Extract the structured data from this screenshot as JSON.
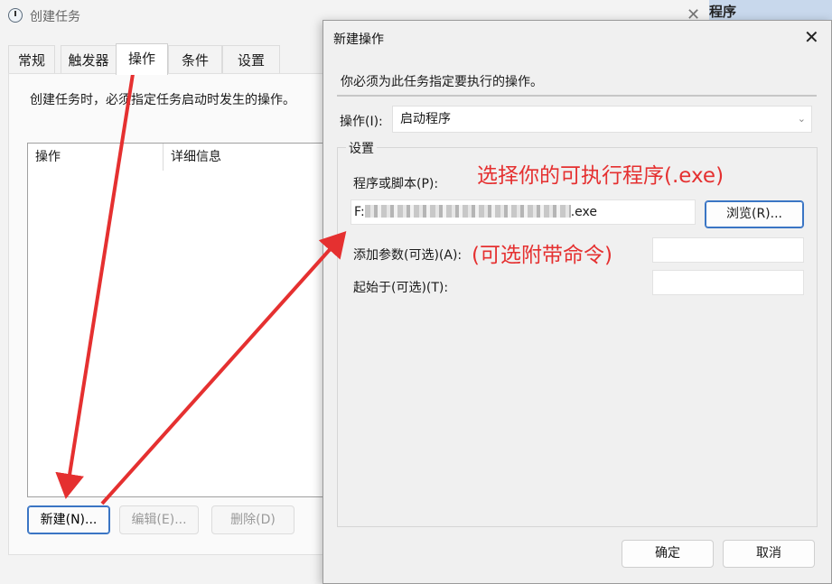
{
  "background_window": {
    "title": "创建任务",
    "tabs": [
      "常规",
      "触发器",
      "操作",
      "条件",
      "设置"
    ],
    "active_tab": "操作",
    "description": "创建任务时，必须指定任务启动时发生的操作。",
    "table_headers": [
      "操作",
      "详细信息"
    ],
    "buttons": {
      "new": "新建(N)...",
      "edit": "编辑(E)...",
      "delete": "删除(D)"
    },
    "right_window_fragment": "程序"
  },
  "dialog": {
    "title": "新建操作",
    "instruction": "你必须为此任务指定要执行的操作。",
    "action_label": "操作(I):",
    "action_value": "启动程序",
    "settings_legend": "设置",
    "program_label": "程序或脚本(P):",
    "program_value_prefix": "F:",
    "program_value_suffix": ".exe",
    "browse_button": "浏览(R)...",
    "args_label": "添加参数(可选)(A):",
    "start_in_label": "起始于(可选)(T):",
    "ok_button": "确定",
    "cancel_button": "取消"
  },
  "annotations": {
    "program_hint": "选择你的可执行程序(.exe)",
    "args_hint": "(可选附带命令)",
    "color": "#e53030"
  },
  "icons": {
    "window": "clock-icon",
    "close": "close-icon",
    "dropdown": "chevron-down-icon"
  }
}
